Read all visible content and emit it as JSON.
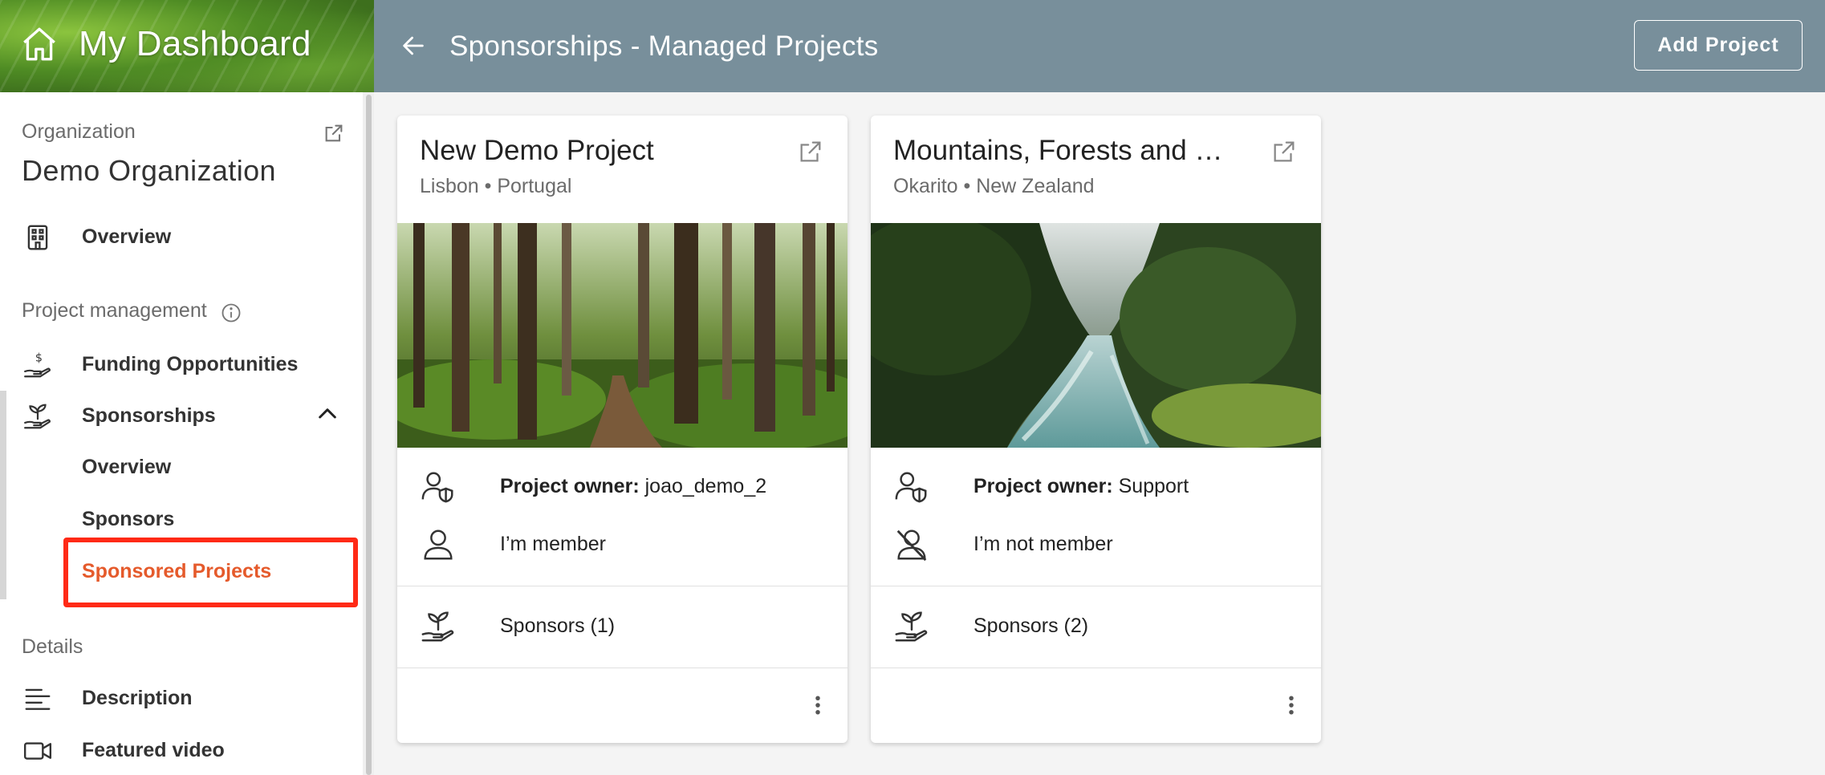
{
  "brand": {
    "title": "My Dashboard"
  },
  "sidebar": {
    "org_label": "Organization",
    "org_name": "Demo Organization",
    "overview": "Overview",
    "section_project_management": "Project management",
    "funding": "Funding Opportunities",
    "sponsorships": "Sponsorships",
    "sub_overview": "Overview",
    "sub_sponsors": "Sponsors",
    "sub_sponsored_projects": "Sponsored Projects",
    "section_details": "Details",
    "description": "Description",
    "featured_video": "Featured video"
  },
  "header": {
    "title": "Sponsorships - Managed Projects",
    "add_button": "Add Project"
  },
  "cards": [
    {
      "title": "New Demo Project",
      "location": "Lisbon • Portugal",
      "owner_label": "Project owner:",
      "owner_value": "joao_demo_2",
      "membership": "I’m member",
      "sponsors": "Sponsors (1)"
    },
    {
      "title": "Mountains, Forests and …",
      "location": "Okarito • New Zealand",
      "owner_label": "Project owner:",
      "owner_value": "Support",
      "membership": "I’m not member",
      "sponsors": "Sponsors (2)"
    }
  ],
  "colors": {
    "topbar": "#788f9b",
    "highlight_box": "#ff2a16",
    "selected_text": "#e55a2b"
  }
}
